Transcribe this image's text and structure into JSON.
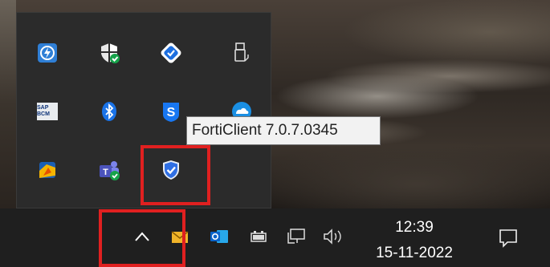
{
  "tooltip": {
    "text": "FortiClient 7.0.7.0345"
  },
  "flyout": {
    "icons": [
      {
        "name": "dell-power-manager-icon",
        "label": ""
      },
      {
        "name": "windows-security-icon",
        "label": ""
      },
      {
        "name": "diamond-app-icon",
        "label": ""
      },
      {
        "name": "usb-device-icon",
        "label": ""
      },
      {
        "name": "sap-bcm-icon",
        "label": "SAP BCM"
      },
      {
        "name": "bluetooth-icon",
        "label": ""
      },
      {
        "name": "s-app-icon",
        "label": "S"
      },
      {
        "name": "cloud-app-icon",
        "label": ""
      },
      {
        "name": "power-app-icon",
        "label": ""
      },
      {
        "name": "teams-icon",
        "label": ""
      },
      {
        "name": "forticlient-shield-icon",
        "label": ""
      }
    ]
  },
  "taskbar": {
    "clock_time": "12:39",
    "clock_date": "15-11-2022"
  },
  "colors": {
    "highlight": "#e02020",
    "taskbar_bg": "#1f1f1f",
    "flyout_bg": "#2b2b2b",
    "accent_blue": "#1a73e8"
  }
}
